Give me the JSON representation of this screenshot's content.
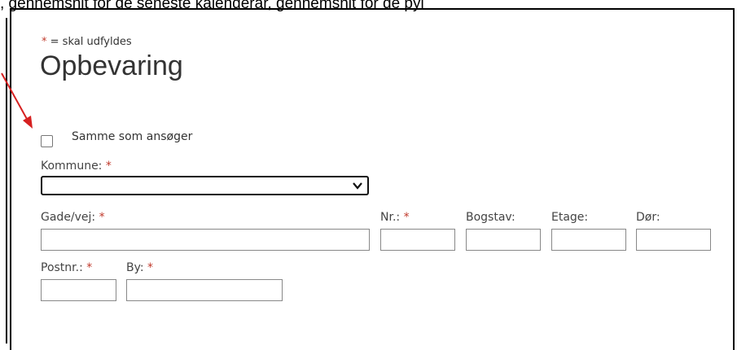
{
  "page": {
    "top_text": ", gennemsnit for de seneste kalenderår, gennemsnit for de pyi",
    "required_star": "*",
    "required_note": "= skal udfyldes",
    "title": "Opbevaring"
  },
  "same_as_applicant": {
    "label": "Samme som ansøger",
    "checked": false
  },
  "kommune": {
    "label": "Kommune:",
    "value": ""
  },
  "address": {
    "street_label": "Gade/vej:",
    "number_label": "Nr.:",
    "letter_label": "Bogstav:",
    "floor_label": "Etage:",
    "door_label": "Dør:",
    "postcode_label": "Postnr.:",
    "city_label": "By:"
  },
  "colors": {
    "required": "#c0392b",
    "arrow": "#d62020"
  }
}
